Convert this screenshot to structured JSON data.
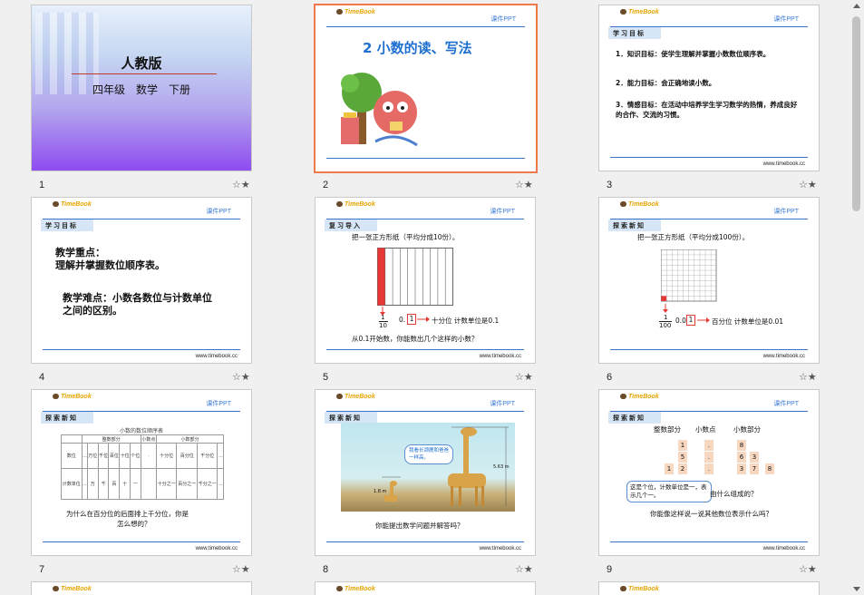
{
  "common": {
    "logo": "TimeBook",
    "kejian": "课件PPT",
    "url": "www.timebook.cc",
    "star": "☆★"
  },
  "slides": [
    {
      "num": "1",
      "title": "人教版",
      "subtitle": "四年级　数学　下册"
    },
    {
      "num": "2",
      "title": "2 小数的读、写法"
    },
    {
      "num": "3",
      "tag": "学习目标",
      "lines": [
        "1．知识目标：使学生理解并掌握小数数位顺序表。",
        "2．能力目标：会正确地读小数。",
        "3．情感目标：在活动中培养学生学习数学的热情，养成良好的合作、交流的习惯。"
      ]
    },
    {
      "num": "4",
      "tag": "学习目标",
      "lines": [
        "教学重点：",
        "理解并掌握数位顺序表。",
        "教学难点：小数各数位与计数单位",
        "之间的区别。"
      ]
    },
    {
      "num": "5",
      "tag": "复习导入",
      "heading": "把一张正方形纸（平均分成10份）。",
      "fraction_top": "1",
      "fraction_bottom": "10",
      "value": "0.",
      "value_box": "1",
      "note": "十分位 计数单位是0.1",
      "question": "从0.1开始数，你能数出几个这样的小数？"
    },
    {
      "num": "6",
      "tag": "探索新知",
      "heading": "把一张正方形纸（平均分成100份）。",
      "fraction_top": "1",
      "fraction_bottom": "100",
      "value": "0.0",
      "value_box": "1",
      "note": "百分位 计数单位是0.01"
    },
    {
      "num": "7",
      "tag": "探索新知",
      "table_title": "小数的数位顺序表",
      "group_headers": [
        "整数部分",
        "小数点",
        "小数部分"
      ],
      "row1_label": "数位",
      "row2_label": "计数单位",
      "row1": [
        "…",
        "万位",
        "千位",
        "百位",
        "十位",
        "个位",
        "·",
        "十分位",
        "百分位",
        "千分位",
        "…"
      ],
      "row2": [
        "…",
        "万",
        "千",
        "百",
        "十",
        "一",
        "",
        "十分之一",
        "百分之一",
        "千分之一",
        "…"
      ],
      "question_1": "为什么在百分位的后面排上千分位，你是",
      "question_2": "怎么想的？"
    },
    {
      "num": "8",
      "tag": "探索新知",
      "bubble": "我看长颈鹿和爸爸一样高。",
      "height_big": "5.63 m",
      "height_small": "1.8 m",
      "question": "你能提出数学问题并解答吗？"
    },
    {
      "num": "9",
      "tag": "探索新知",
      "labels": [
        "整数部分",
        "小数点",
        "小数部分"
      ],
      "int_digits": [
        "1",
        "5",
        "1",
        "2"
      ],
      "points": [
        ".",
        ".",
        "."
      ],
      "dec_digits": [
        "8",
        "6",
        "3",
        "3",
        "7",
        "8"
      ],
      "callout": "这是个位，计数单位是一，表示几个一。",
      "partial": "由什么组成的？",
      "question": "你能像这样说一说其他数位表示什么吗？"
    }
  ],
  "peek": [
    "TimeBook",
    "TimeBook",
    "TimeBook"
  ]
}
